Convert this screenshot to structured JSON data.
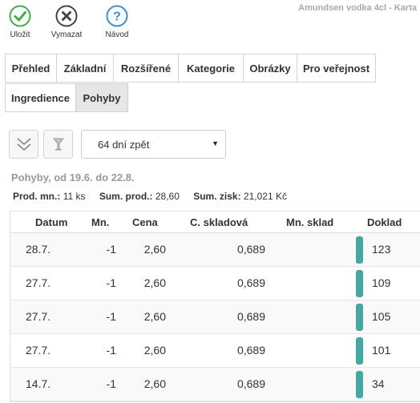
{
  "window": {
    "title": "Amundsen vodka 4cl - Karta"
  },
  "toolbar": {
    "save_label": "Uložit",
    "clear_label": "Vymazat",
    "help_label": "Návod",
    "colors": {
      "save": "#3fae49",
      "clear": "#444444",
      "help": "#3a8fd9"
    }
  },
  "tabs": [
    {
      "label": "Přehled",
      "active": false
    },
    {
      "label": "Základní",
      "active": false
    },
    {
      "label": "Rozšířené",
      "active": false
    },
    {
      "label": "Kategorie",
      "active": false
    },
    {
      "label": "Obrázky",
      "active": false
    },
    {
      "label": "Pro veřejnost",
      "active": false
    },
    {
      "label": "Ingredience",
      "active": false
    },
    {
      "label": "Pohyby",
      "active": true
    }
  ],
  "controls": {
    "collapse_icon": "double-chevron-down-icon",
    "filter_icon": "glass-filter-icon",
    "period_select": "64 dní zpět"
  },
  "movements": {
    "period": "Pohyby, od 19.6. do 22.8.",
    "summary": {
      "qty_label": "Prod. mn.:",
      "qty_value": "11 ks",
      "sales_label": "Sum. prod.:",
      "sales_value": "28,60",
      "profit_label": "Sum. zisk:",
      "profit_value": "21,021 Kč"
    },
    "columns": [
      "Datum",
      "Mn.",
      "Cena",
      "C. skladová",
      "Mn. sklad",
      "Doklad"
    ],
    "rows": [
      {
        "date": "28.7.",
        "qty": "-1",
        "price": "2,60",
        "stock_price": "0,689",
        "stock_qty": "",
        "doc": "123"
      },
      {
        "date": "27.7.",
        "qty": "-1",
        "price": "2,60",
        "stock_price": "0,689",
        "stock_qty": "",
        "doc": "109"
      },
      {
        "date": "27.7.",
        "qty": "-1",
        "price": "2,60",
        "stock_price": "0,689",
        "stock_qty": "",
        "doc": "105"
      },
      {
        "date": "27.7.",
        "qty": "-1",
        "price": "2,60",
        "stock_price": "0,689",
        "stock_qty": "",
        "doc": "101"
      },
      {
        "date": "14.7.",
        "qty": "-1",
        "price": "2,60",
        "stock_price": "0,689",
        "stock_qty": "",
        "doc": "34"
      }
    ],
    "doc_bar_color": "#45a8a0"
  }
}
